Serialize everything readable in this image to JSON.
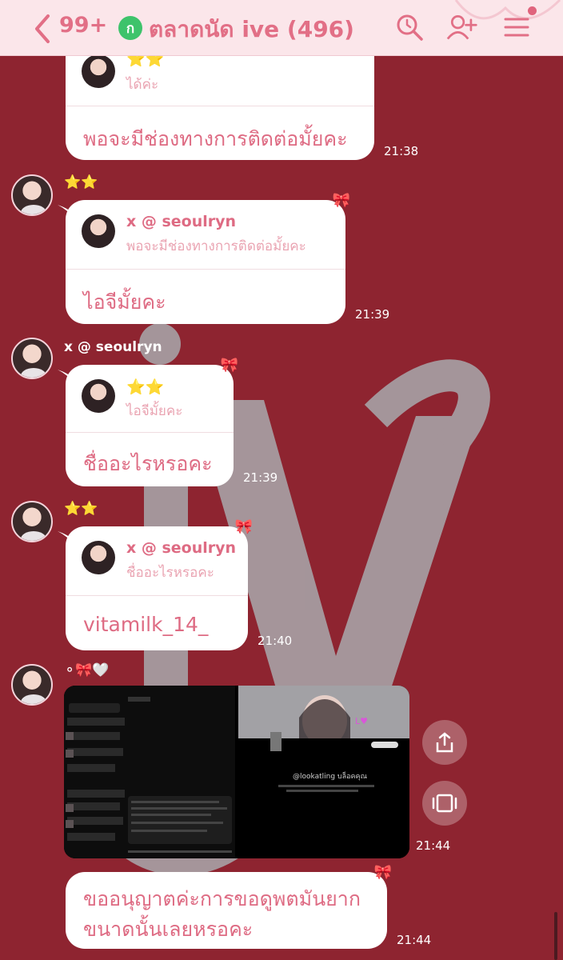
{
  "header": {
    "unread_count": "99+",
    "group_badge": "ก",
    "title": "ตลาดนัด ive (496)"
  },
  "messages": [
    {
      "quote_text": "ได้ค่ะ",
      "body": "พอจะมีช่องทางการติดต่อมั้ยคะ",
      "time": "21:38"
    },
    {
      "sender": "⭐⭐",
      "quote_name": "x @ seoulryn",
      "quote_text": "พอจะมีช่องทางการติดต่อมั้ยคะ",
      "body": "ไอจีมั้ยคะ",
      "time": "21:39"
    },
    {
      "sender": "x @ seoulryn",
      "quote_name": "⭐⭐",
      "quote_text": "ไอจีมั้ยคะ",
      "body": "ชื่ออะไรหรอคะ",
      "time": "21:39"
    },
    {
      "sender": "⭐⭐",
      "quote_name": "x @ seoulryn",
      "quote_text": "ชื่ออะไรหรอคะ",
      "body": "vitamilk_14_",
      "time": "21:40"
    },
    {
      "sender": "⚬🎀🤍",
      "image_caption": "@lookatling บล็อคคุณ",
      "time": "21:44"
    },
    {
      "body_line1": "ขออนุญาตค่ะการขอดูพตมันยาก",
      "body_line2": "ขนาดนั้นเลยหรอคะ",
      "time": "21:44"
    }
  ],
  "colors": {
    "background": "#8e2430",
    "header": "#fbe6ea",
    "accent": "#de6b83",
    "bubble": "#ffffff"
  },
  "icons": [
    "back-chevron-icon",
    "search-icon",
    "add-friend-icon",
    "menu-icon",
    "share-icon",
    "gallery-icon"
  ]
}
